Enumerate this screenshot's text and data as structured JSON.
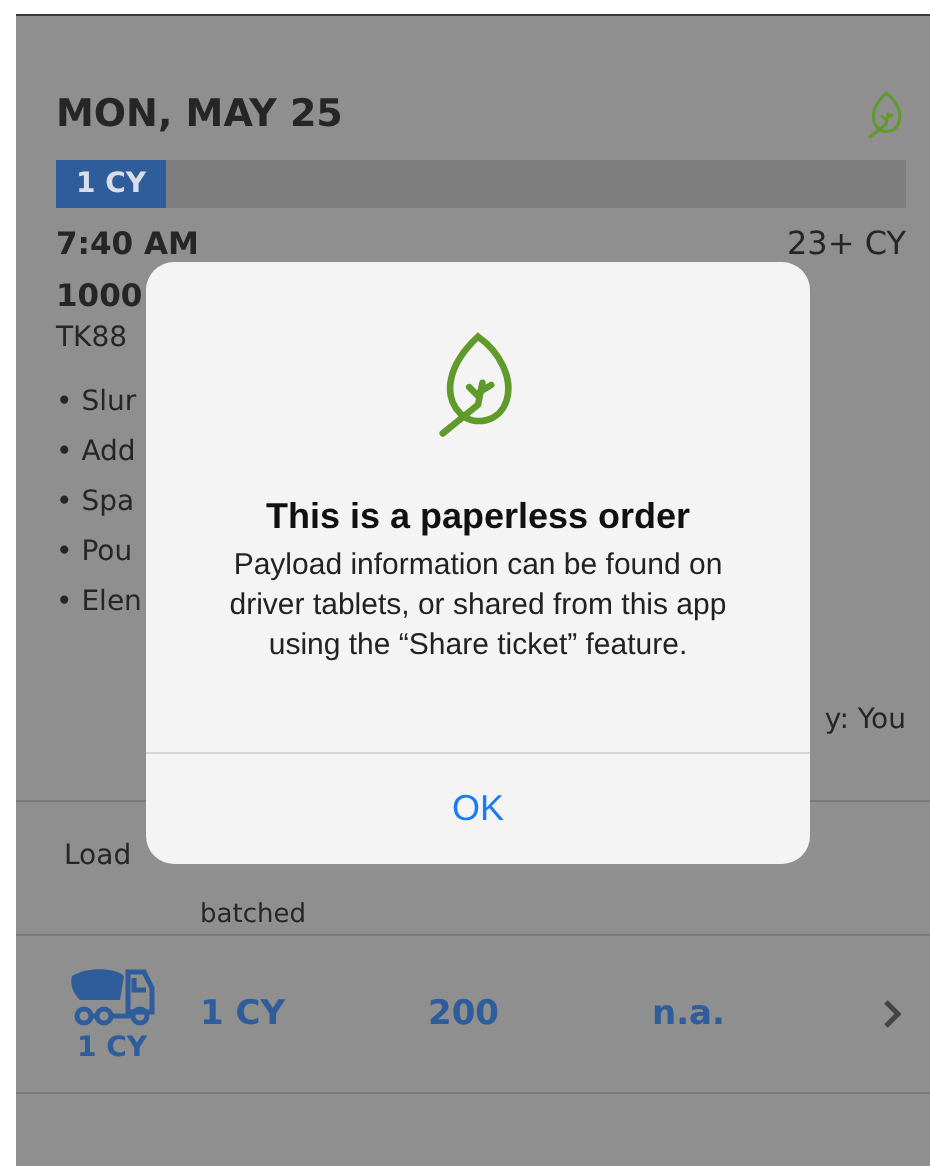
{
  "header": {
    "date": "MON, MAY 25"
  },
  "progress": {
    "label": "1 CY",
    "level": 0.13
  },
  "order": {
    "time": "7:40 AM",
    "quantity": "23+ CY",
    "number": "1000",
    "ticket": "TK88"
  },
  "notes": [
    "• Slur",
    "• Add",
    "• Spa",
    "• Pou",
    "• Elen"
  ],
  "ordered_by": "y: You",
  "load_header": {
    "label": "Load",
    "status": "batched"
  },
  "loads": [
    {
      "truck_label": "1 CY",
      "quantity": "1 CY",
      "column_3": "200",
      "column_4": "n.a."
    }
  ],
  "dialog": {
    "title": "This is a paperless order",
    "message": "Payload information can be found on driver tablets, or shared from this app using the “Share ticket” feature.",
    "button": "OK"
  }
}
